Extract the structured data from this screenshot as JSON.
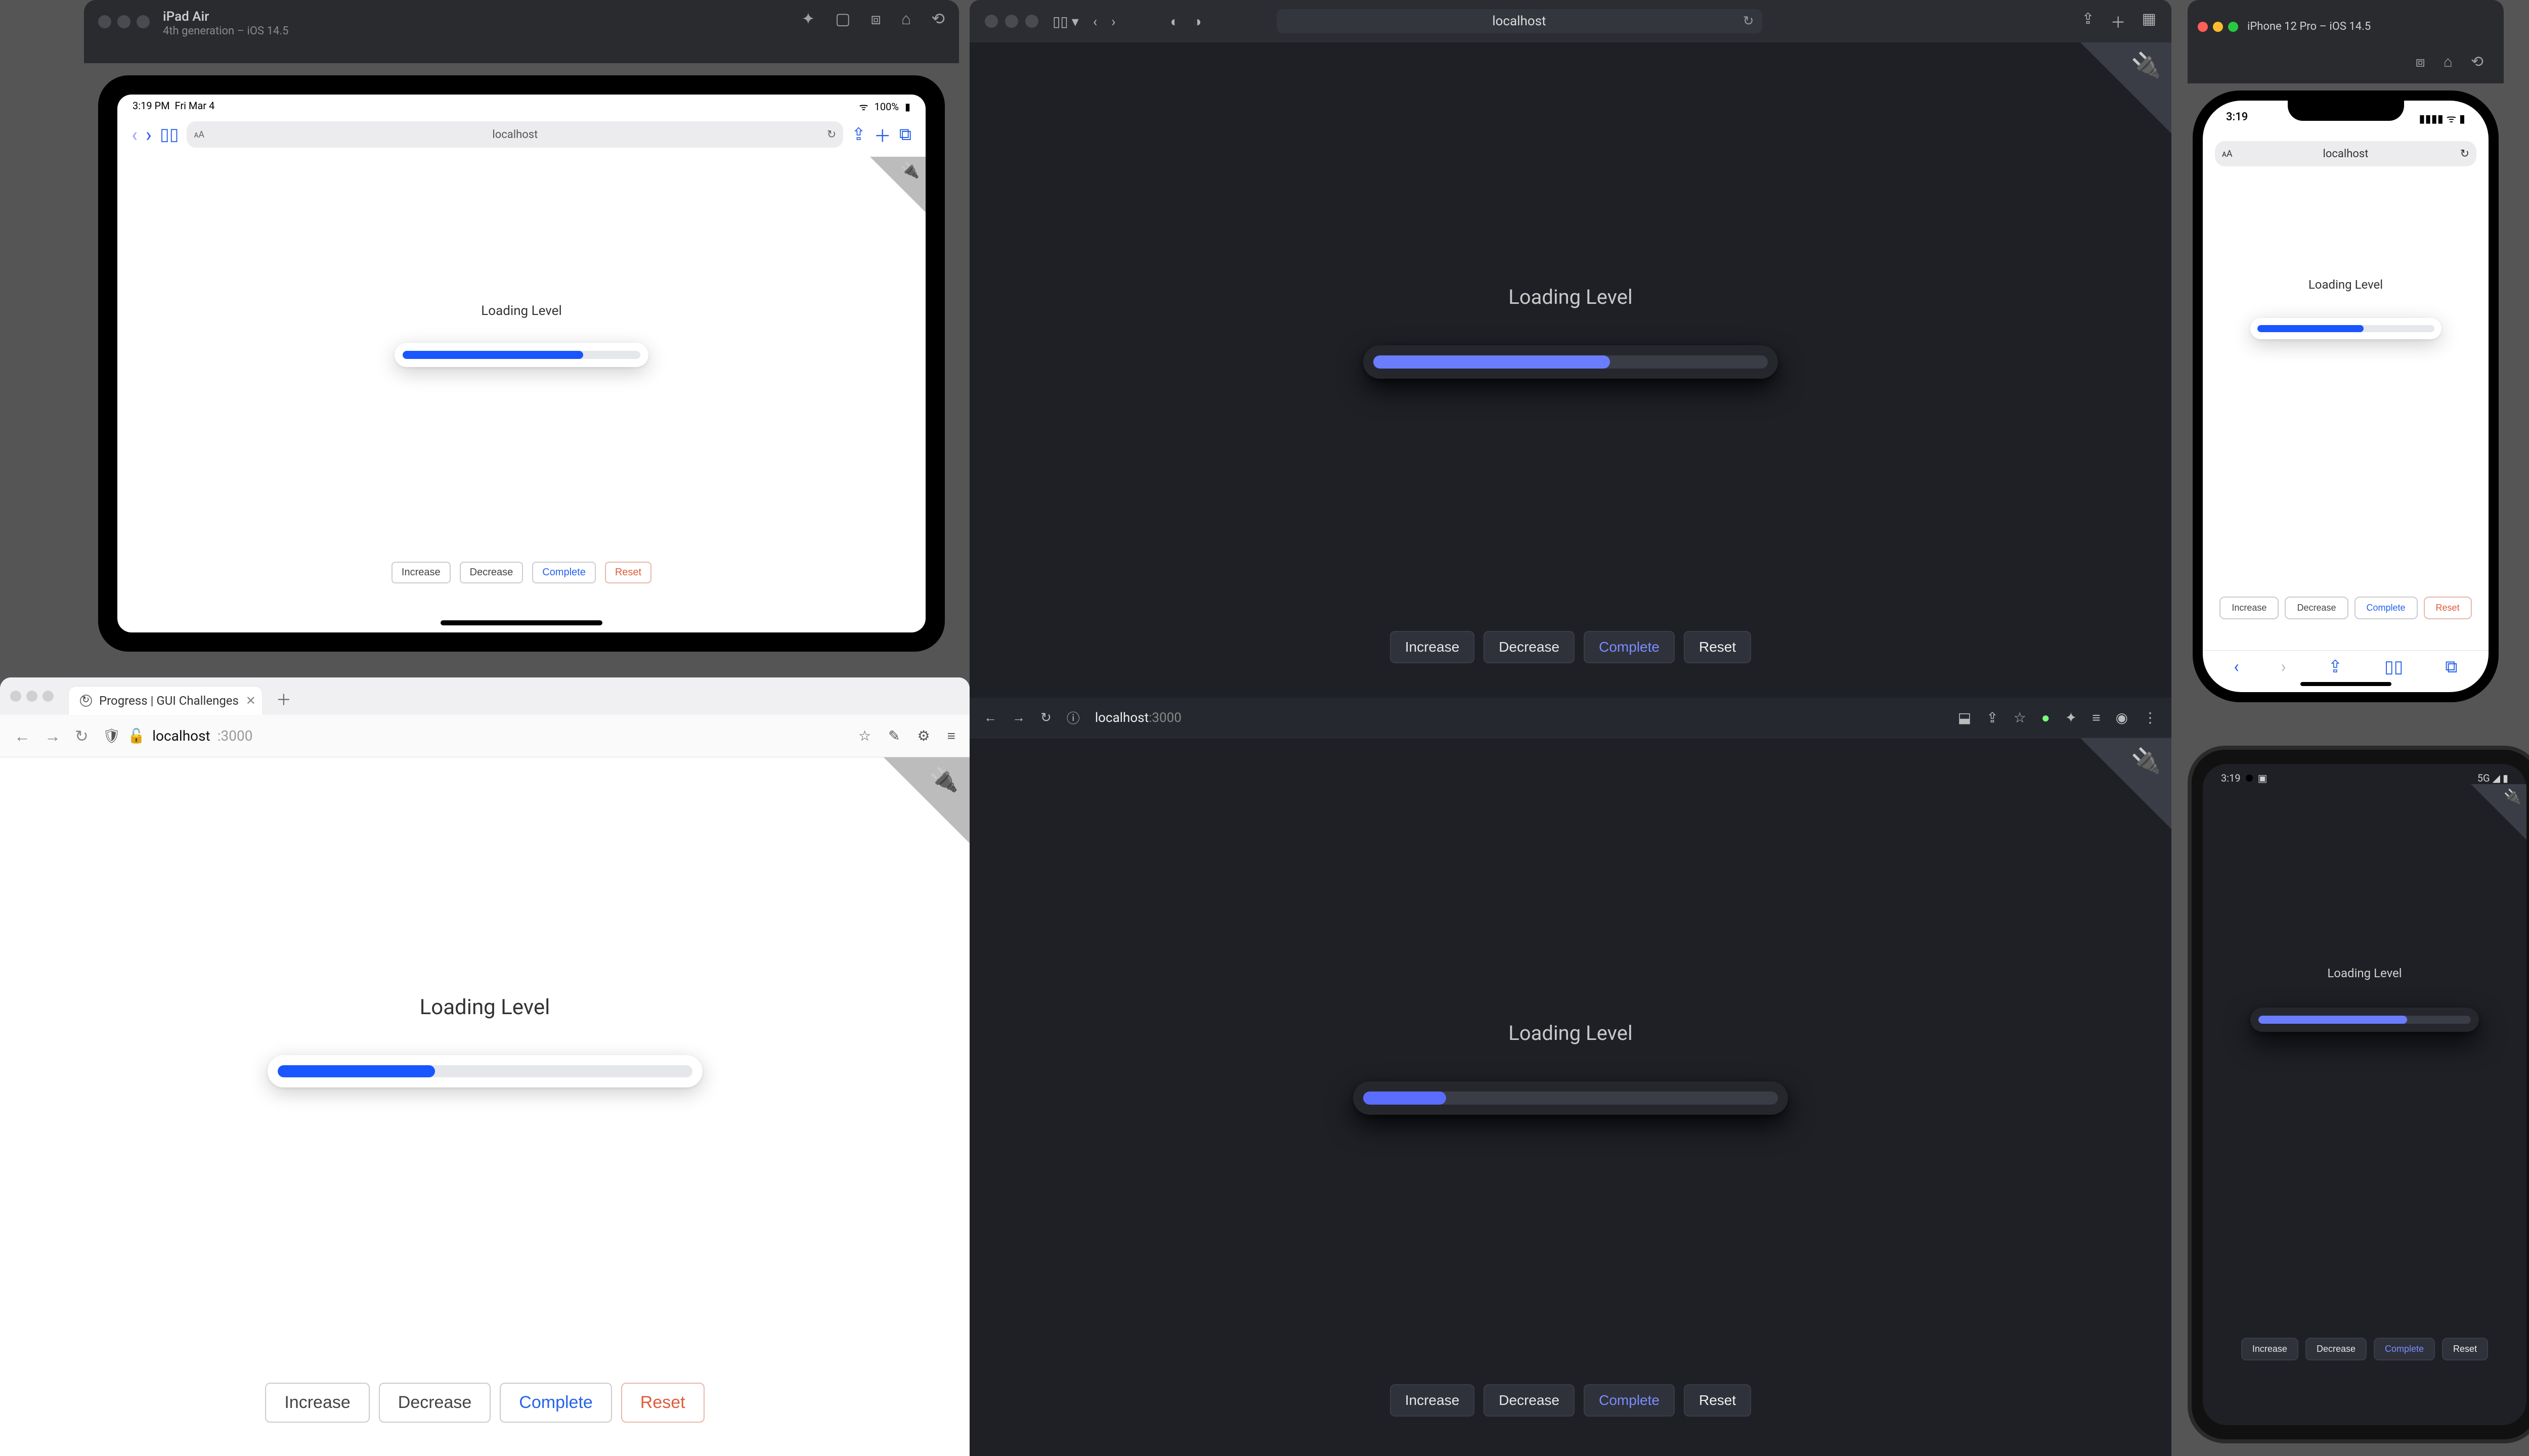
{
  "app": {
    "label": "Loading Level",
    "buttons": {
      "increase": "Increase",
      "decrease": "Decrease",
      "complete": "Complete",
      "reset": "Reset"
    }
  },
  "ipad_sim": {
    "window_title": "iPad Air",
    "window_subtitle": "4th generation – iOS 14.5",
    "status": {
      "time": "3:19 PM",
      "date": "Fri Mar 4",
      "wifi": "100%"
    },
    "url": "localhost",
    "progress_pct": 76
  },
  "safari_top": {
    "url": "localhost",
    "progress_pct": 60
  },
  "iphone_sim": {
    "window_title": "iPhone 12 Pro – iOS 14.5",
    "status_time": "3:19",
    "url": "localhost",
    "progress_pct": 60
  },
  "firefox": {
    "tab_title": "Progress | GUI Challenges",
    "host": "localhost",
    "port": ":3000",
    "progress_pct": 38
  },
  "safari_bot": {
    "host": "localhost",
    "port": ":3000",
    "progress_pct": 20
  },
  "android": {
    "status_time": "3:19",
    "progress_pct": 70
  }
}
